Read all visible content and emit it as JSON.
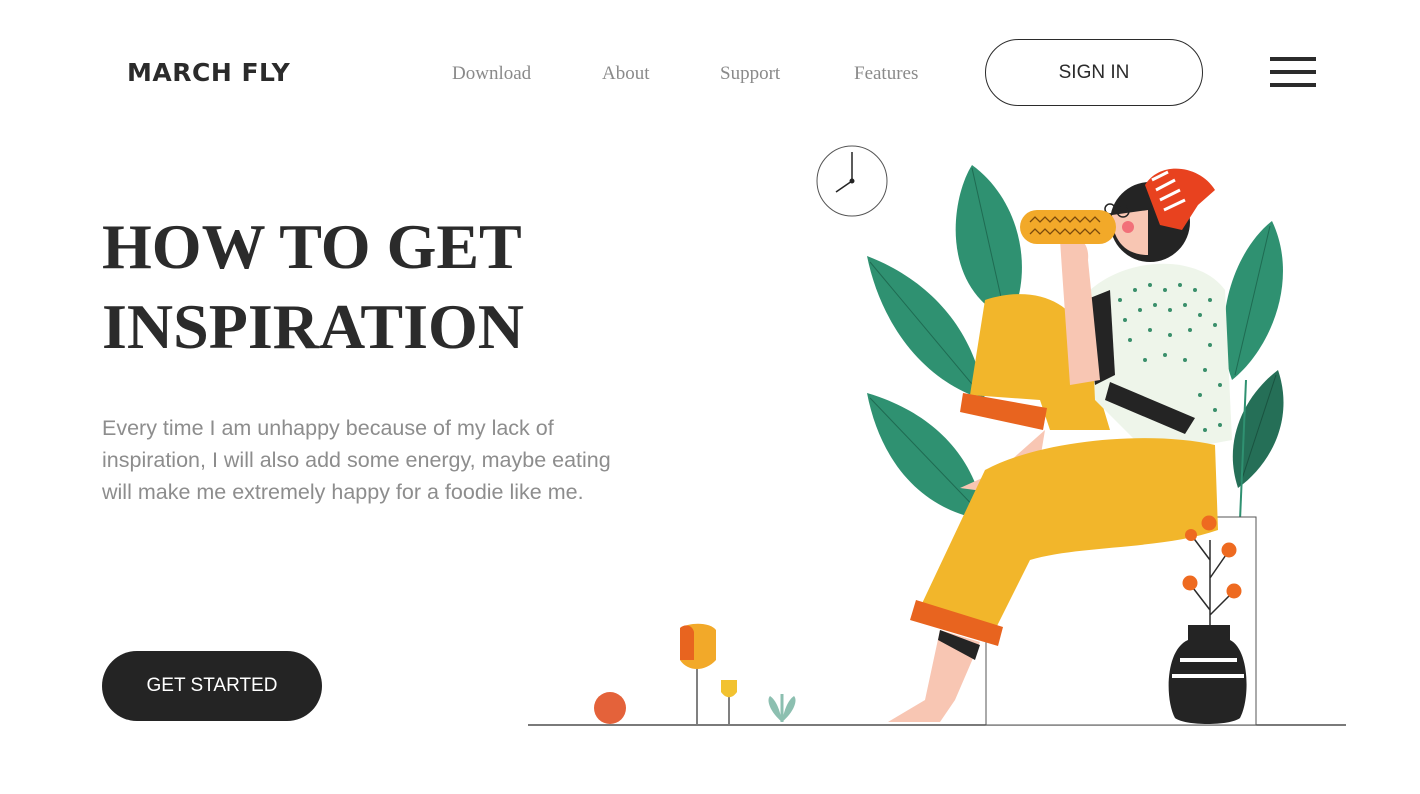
{
  "header": {
    "logo": "MARCH FLY",
    "nav": {
      "download": "Download",
      "about": "About",
      "support": "Support",
      "features": "Features"
    },
    "sign_in": "SIGN IN",
    "menu_icon": "hamburger-menu-icon"
  },
  "hero": {
    "headline_line1": "HOW TO GET",
    "headline_line2": "INSPIRATION",
    "description_line1": "Every time I am unhappy because of my lack of",
    "description_line2": "inspiration, I will also add some energy, maybe eating",
    "description_line3": "will make me extremely happy for a foodie like me.",
    "cta": "GET STARTED"
  },
  "illustration": {
    "subject": "woman-eating-corn",
    "palette": {
      "leaf": "#2f9171",
      "pants": "#f2b62b",
      "cuff": "#e8641f",
      "hat": "#e8421f",
      "skin": "#f8c6b3",
      "ink": "#242424",
      "berries": "#ee6a20"
    }
  }
}
